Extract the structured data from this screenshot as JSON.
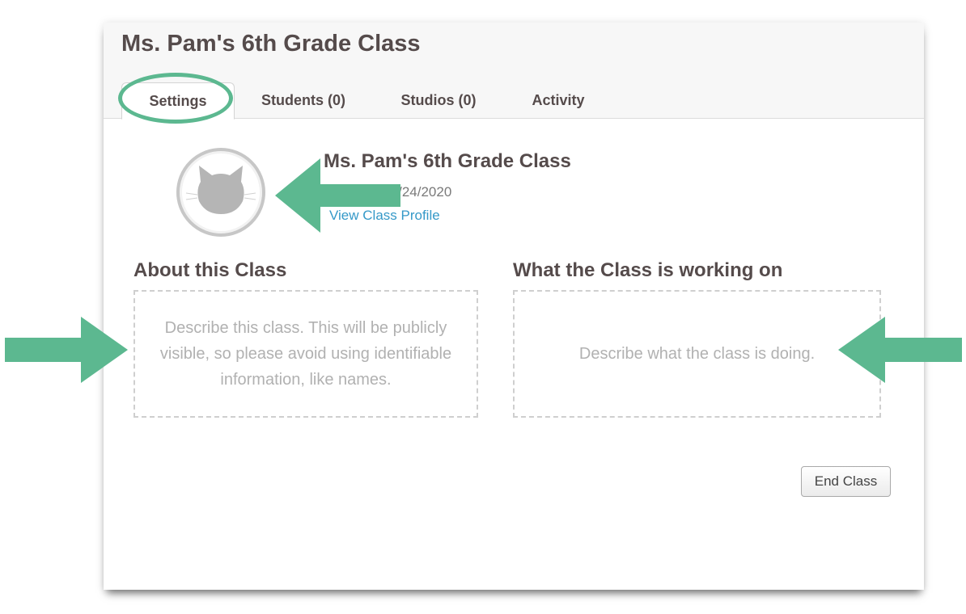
{
  "page_title": "Ms. Pam's 6th Grade Class",
  "tabs": [
    {
      "label": "Settings",
      "active": true
    },
    {
      "label": "Students (0)",
      "active": false
    },
    {
      "label": "Studios (0)",
      "active": false
    },
    {
      "label": "Activity",
      "active": false
    }
  ],
  "profile": {
    "class_name": "Ms. Pam's 6th Grade Class",
    "created_text": "Created 03/24/2020",
    "profile_link": "View Class Profile",
    "avatar_icon": "cat-icon"
  },
  "about": {
    "title": "About this Class",
    "placeholder": "Describe this class. This will be publicly visible, so please avoid using identifiable information, like names."
  },
  "working_on": {
    "title": "What the Class is working on",
    "placeholder": "Describe what the class is doing."
  },
  "end_button": "End Class",
  "colors": {
    "annotation": "#5cb890",
    "link": "#3599c8",
    "heading": "#554b4b",
    "placeholder": "#b1b1b1"
  }
}
